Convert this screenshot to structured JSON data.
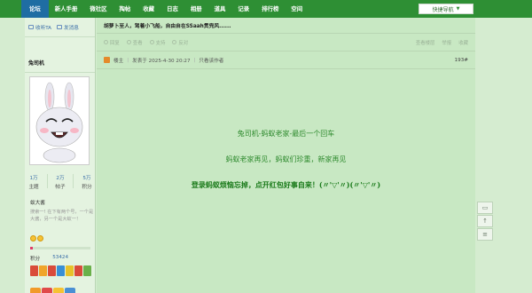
{
  "topnav": {
    "items": [
      "论坛",
      "新人手册",
      "微社区",
      "掏帖",
      "收藏",
      "日志",
      "相册",
      "道具",
      "记录",
      "排行榜",
      "空间"
    ],
    "quicknav_label": "快捷导航"
  },
  "sidebar": {
    "follow_label": "收听TA",
    "message_label": "发消息",
    "username": "兔司机",
    "stats": [
      {
        "value": "1万",
        "label": "主题"
      },
      {
        "value": "2万",
        "label": "帖子"
      },
      {
        "value": "5万",
        "label": "积分"
      }
    ],
    "signature_title": "蚁大酱",
    "signature_text": "搜索一! 在下有两个号，一个是大酱，另一个是大蚁一！",
    "points_label": "积分",
    "points_value": "53424",
    "level_progress": 0.05
  },
  "main": {
    "notice": "胡萝卜至人，驾着小飞船，自由自在SSaah贯兜风......",
    "toolbar": {
      "items": [
        "回复",
        "查看",
        "支持",
        "反对"
      ],
      "right_items": [
        "查看楼层",
        "举报",
        "收藏"
      ]
    },
    "post": {
      "author_tag": "楼主",
      "posted_at": "发表于 2025-4-30 20:27",
      "only_author": "只看该作者",
      "floor": "193#"
    },
    "content": {
      "line1": "兔司机-蚂蚁老家-最后一个回车",
      "line2": "蚂蚁老家再见，蚂蚁们珍重，新家再见",
      "line3": "登录蚂蚁烦恼忘掉，点开红包好事自来！(〃'▽'〃)(〃'▽'〃)"
    }
  },
  "colors": {
    "nav_green": "#2e8f34",
    "home_blue": "#1f6da3",
    "content_green": "#2e8a2e"
  }
}
